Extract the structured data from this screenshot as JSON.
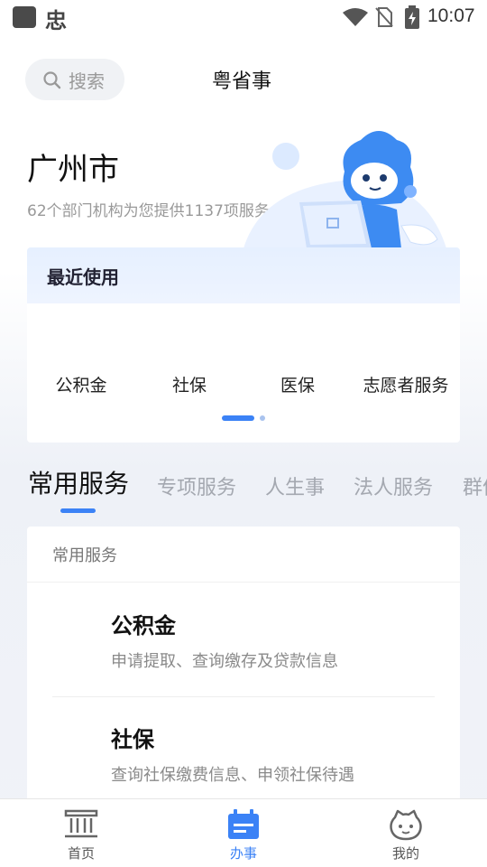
{
  "status_bar": {
    "app_glyph": "忠",
    "time": "10:07"
  },
  "header": {
    "search_label": "搜索",
    "title": "粤省事"
  },
  "city": {
    "name": "广州市",
    "subtitle": "62个部门机构为您提供1137项服务"
  },
  "recent": {
    "title": "最近使用",
    "items": [
      "公积金",
      "社保",
      "医保",
      "志愿者服务"
    ],
    "pager": {
      "pages": 2,
      "current": 1
    }
  },
  "tabs": [
    "常用服务",
    "专项服务",
    "人生事",
    "法人服务",
    "群体服务"
  ],
  "tabs_active": 0,
  "services": {
    "section_title": "常用服务",
    "items": [
      {
        "name": "公积金",
        "desc": "申请提取、查询缴存及贷款信息"
      },
      {
        "name": "社保",
        "desc": "查询社保缴费信息、申领社保待遇"
      }
    ]
  },
  "bottom_nav": {
    "items": [
      {
        "label": "首页",
        "icon": "building-icon"
      },
      {
        "label": "办事",
        "icon": "calendar-icon"
      },
      {
        "label": "我的",
        "icon": "face-icon"
      }
    ],
    "active": 1
  },
  "colors": {
    "accent": "#3b82f6",
    "muted_text": "#999999"
  }
}
